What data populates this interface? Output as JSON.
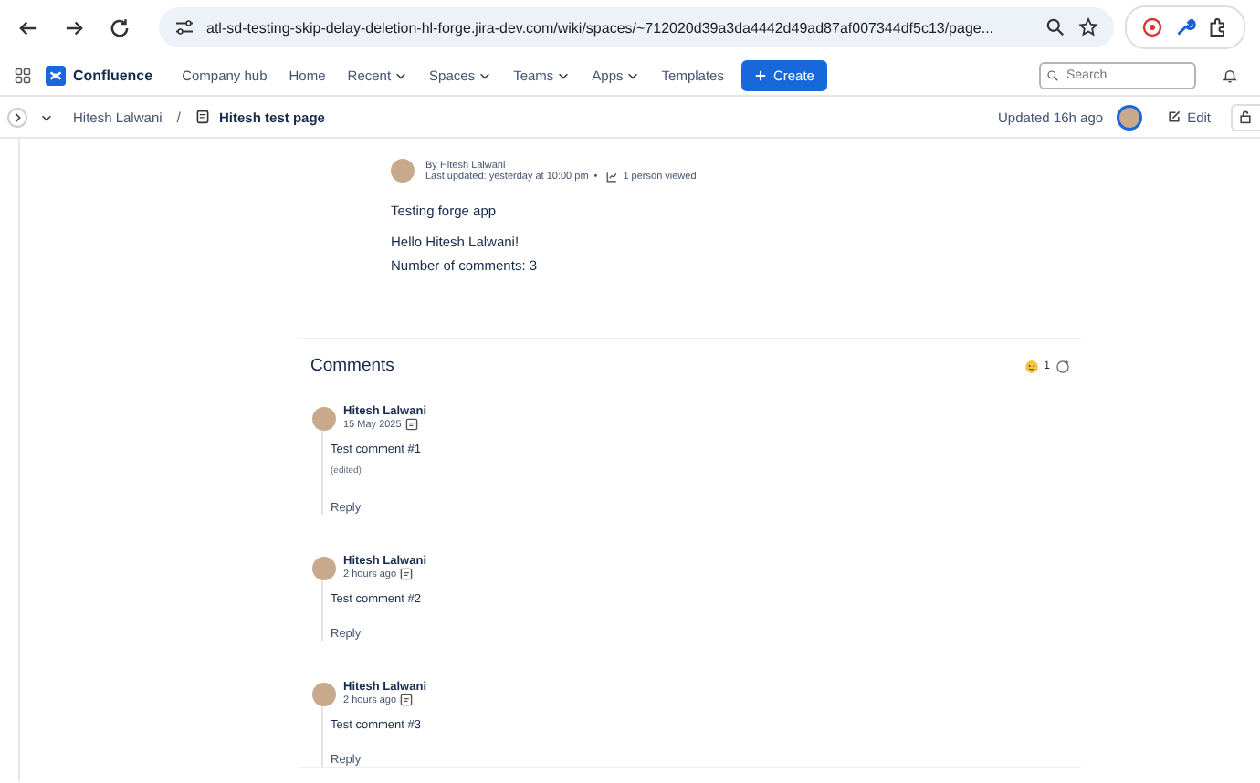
{
  "browser": {
    "url": "atl-sd-testing-skip-delay-deletion-hl-forge.jira-dev.com/wiki/spaces/~712020d39a3da4442d49ad87af007344df5c13/page..."
  },
  "nav": {
    "logo": "Confluence",
    "items": [
      {
        "label": "Company hub",
        "has_menu": false
      },
      {
        "label": "Home",
        "has_menu": false
      },
      {
        "label": "Recent",
        "has_menu": true
      },
      {
        "label": "Spaces",
        "has_menu": true
      },
      {
        "label": "Teams",
        "has_menu": true
      },
      {
        "label": "Apps",
        "has_menu": true
      },
      {
        "label": "Templates",
        "has_menu": false
      }
    ],
    "create": "Create",
    "search": {
      "placeholder": "Search"
    }
  },
  "breadcrumb": {
    "space": "Hitesh Lalwani",
    "separator": "/",
    "page": "Hitesh test page",
    "updated": "Updated 16h ago",
    "edit": "Edit"
  },
  "page": {
    "byline": "By Hitesh Lalwani",
    "last_updated": "Last updated: yesterday at 10:00 pm",
    "bullet": "•",
    "views": "1 person viewed",
    "paragraphs": [
      "Testing forge app",
      "Hello Hitesh Lalwani!",
      "Number of comments: 3"
    ]
  },
  "comments": {
    "title": "Comments",
    "reaction_count": "1",
    "items": [
      {
        "author": "Hitesh Lalwani",
        "time": "15 May 2025",
        "text": "Test comment #1",
        "edited": "(edited)",
        "reply": "Reply"
      },
      {
        "author": "Hitesh Lalwani",
        "time": "2 hours ago",
        "text": "Test comment #2",
        "reply": "Reply"
      },
      {
        "author": "Hitesh Lalwani",
        "time": "2 hours ago",
        "text": "Test comment #3",
        "reply": "Reply"
      }
    ]
  }
}
